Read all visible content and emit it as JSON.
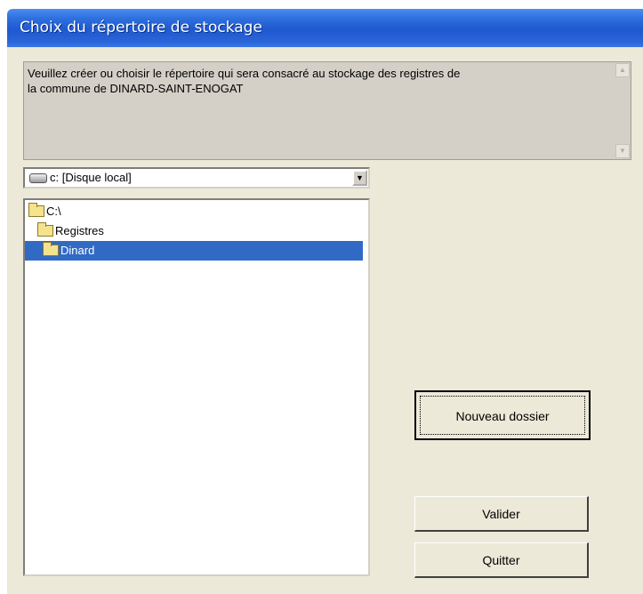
{
  "window": {
    "title": "Choix du répertoire de stockage"
  },
  "message": {
    "line1": "Veuillez créer ou choisir le répertoire qui sera consacré au stockage des registres de",
    "line2": "la commune de DINARD-SAINT-ENOGAT"
  },
  "drive": {
    "label": "c: [Disque local]",
    "icon": "drive-icon"
  },
  "directories": [
    {
      "label": "C:\\",
      "icon": "open-folder-icon",
      "selected": false
    },
    {
      "label": "Registres",
      "icon": "open-folder-icon",
      "selected": false
    },
    {
      "label": "Dinard",
      "icon": "open-folder-icon",
      "selected": true
    }
  ],
  "buttons": {
    "new_folder": "Nouveau dossier",
    "validate": "Valider",
    "quit": "Quitter"
  },
  "colors": {
    "titlebar": "#2a64d8",
    "dialog_bg": "#ece9d8",
    "selection": "#316ac5"
  }
}
